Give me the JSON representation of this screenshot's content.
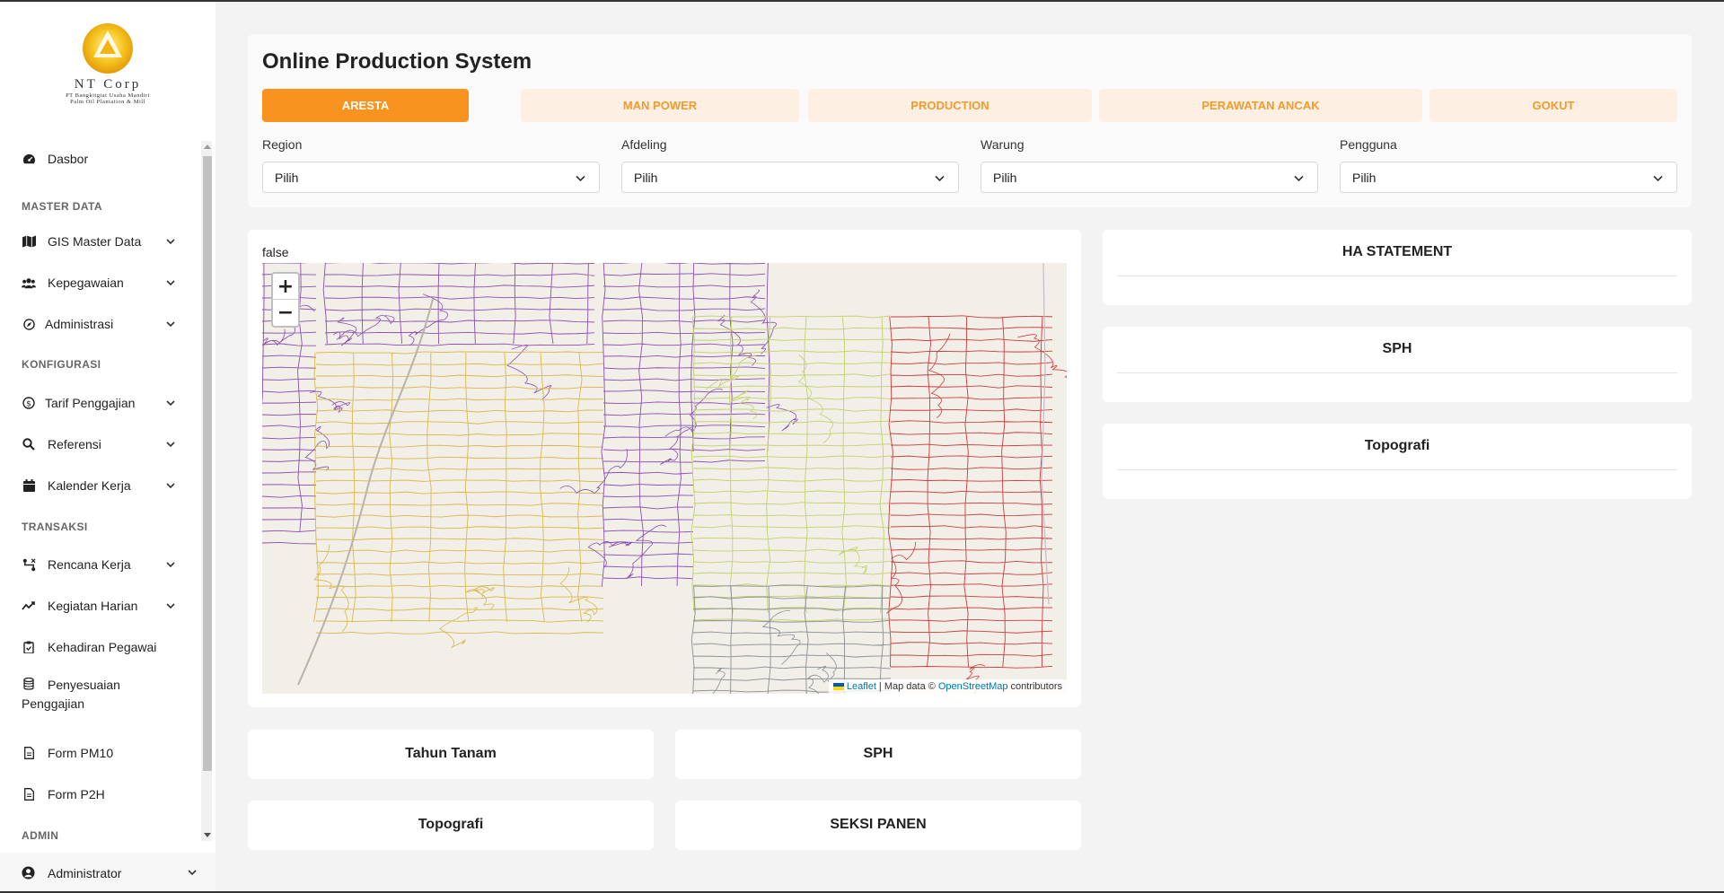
{
  "logo": {
    "corp": "NT Corp",
    "line1": "PT Bangkitgiat Usaha Mandiri",
    "line2": "Palm Oil Plantation & Mill"
  },
  "sidebar": {
    "items": [
      {
        "label": "Dasbor",
        "icon": "gauge-icon"
      },
      {
        "section": "MASTER DATA"
      },
      {
        "label": "GIS Master Data",
        "icon": "map-icon"
      },
      {
        "label": "Kepegawaian",
        "icon": "users-icon"
      },
      {
        "label": "Administrasi",
        "icon": "compass-icon"
      },
      {
        "section": "KONFIGURASI"
      },
      {
        "label": "Tarif Penggajian",
        "icon": "dollar-circle-icon"
      },
      {
        "label": "Referensi",
        "icon": "search-icon"
      },
      {
        "label": "Kalender Kerja",
        "icon": "calendar-icon"
      },
      {
        "section": "TRANSAKSI"
      },
      {
        "label": "Rencana Kerja",
        "icon": "route-icon"
      },
      {
        "label": "Kegiatan Harian",
        "icon": "chart-line-icon"
      },
      {
        "label": "Kehadiran Pegawai",
        "icon": "clipboard-icon"
      },
      {
        "label": "Penyesuaian",
        "label2": "Penggajian",
        "icon": "database-icon"
      },
      {
        "label": "Form PM10",
        "icon": "file-icon"
      },
      {
        "label": "Form P2H",
        "icon": "file-icon"
      },
      {
        "section": "ADMIN"
      }
    ],
    "user": {
      "label": "Administrator",
      "icon": "user-circle-icon"
    }
  },
  "header": {
    "title": "Online Production System",
    "tabs": [
      {
        "label": "ARESTA",
        "active": true
      },
      {
        "label": "MAN POWER",
        "active": false
      },
      {
        "label": "PRODUCTION",
        "active": false
      },
      {
        "label": "PERAWATAN ANCAK",
        "active": false
      },
      {
        "label": "GOKUT",
        "active": false
      }
    ],
    "filters": [
      {
        "label": "Region",
        "value": "Pilih"
      },
      {
        "label": "Afdeling",
        "value": "Pilih"
      },
      {
        "label": "Warung",
        "value": "Pilih"
      },
      {
        "label": "Pengguna",
        "value": "Pilih"
      }
    ]
  },
  "map": {
    "flag_text": "false",
    "zoom_in": "+",
    "zoom_out": "−",
    "attribution": {
      "leaflet": "Leaflet",
      "middle": "| Map data ©",
      "osm": "OpenStreetMap",
      "end": "contributors"
    },
    "colors": {
      "purple": "#8a4fae",
      "yellow": "#d8b84a",
      "lime": "#c2d16a",
      "red": "#cc3b3b",
      "gray": "#8a8f93"
    }
  },
  "cards": {
    "ha_statement": "HA STATEMENT",
    "sph_right": "SPH",
    "topografi_right": "Topografi",
    "tahun_tanam": "Tahun Tanam",
    "sph_bottom": "SPH",
    "topografi_bottom": "Topografi",
    "seksi_panen": "SEKSI PANEN"
  },
  "colors": {
    "accent": "#f7931e",
    "accent_light": "#fdf0e3"
  }
}
